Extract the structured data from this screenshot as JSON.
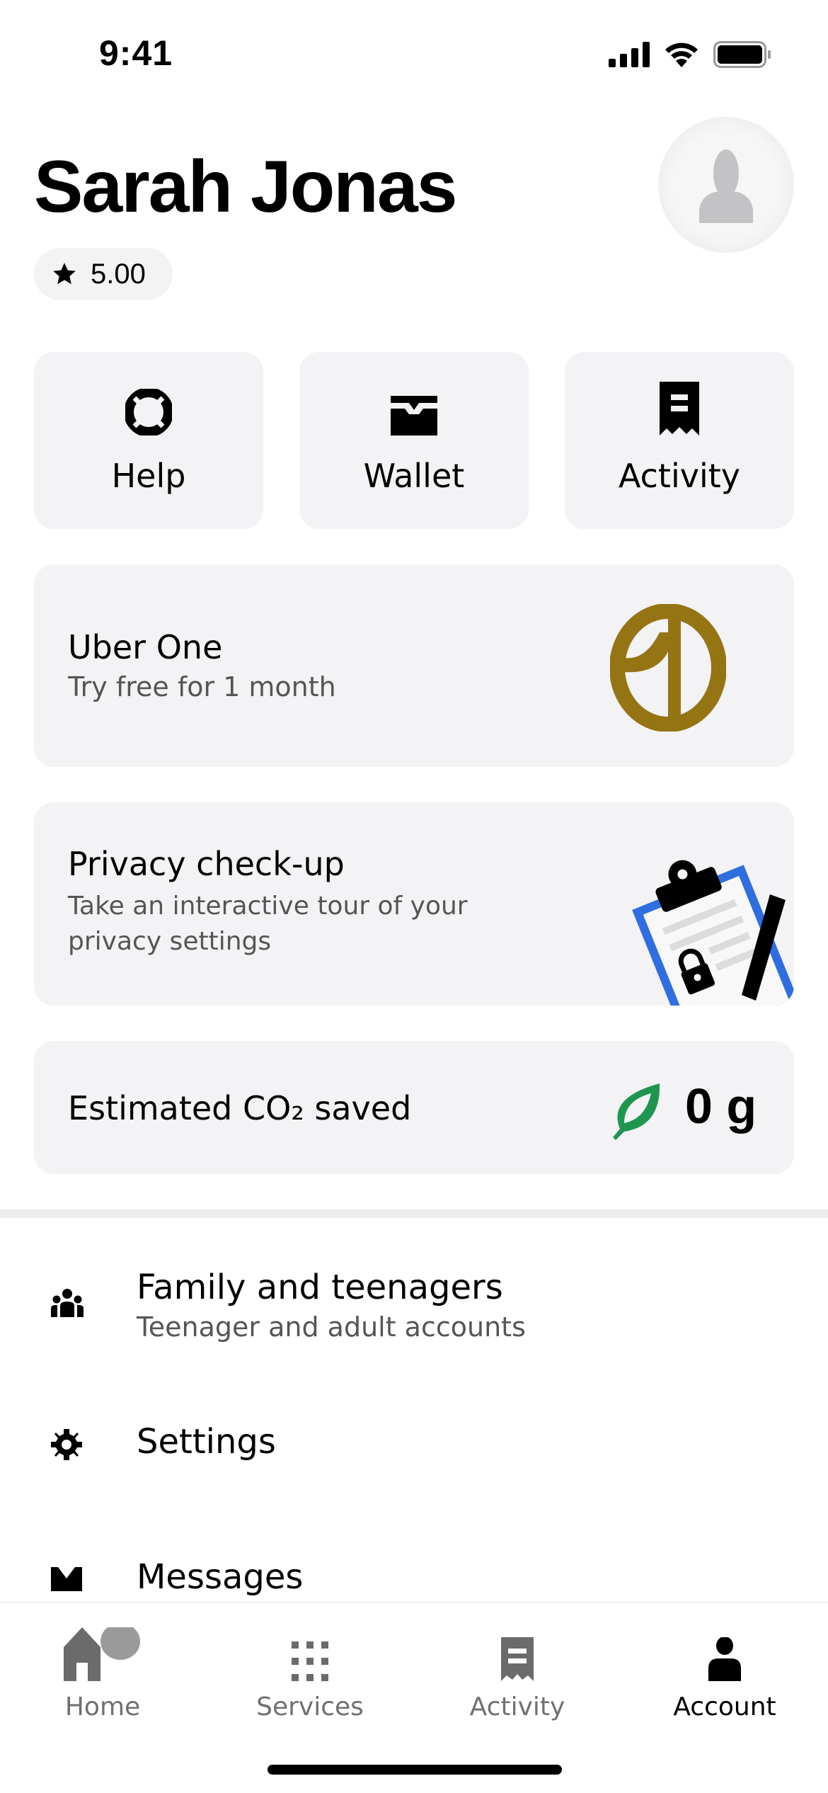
{
  "status_bar": {
    "time": "9:41"
  },
  "profile": {
    "name": "Sarah Jonas",
    "rating": "5.00"
  },
  "tiles": [
    {
      "label": "Help",
      "icon": "lifebuoy-icon"
    },
    {
      "label": "Wallet",
      "icon": "wallet-icon"
    },
    {
      "label": "Activity",
      "icon": "receipt-icon"
    }
  ],
  "uber_one": {
    "title": "Uber One",
    "subtitle": "Try free for 1 month",
    "accent": "#957414"
  },
  "privacy": {
    "title": "Privacy check-up",
    "subtitle": "Take an interactive tour of your privacy settings",
    "accent": "#2f6ee0"
  },
  "co2": {
    "label": "Estimated CO₂ saved",
    "value": "0 g",
    "accent": "#1e9650"
  },
  "menu": [
    {
      "title": "Family and teenagers",
      "subtitle": "Teenager and adult accounts",
      "icon": "family-icon"
    },
    {
      "title": "Settings",
      "icon": "gear-icon"
    },
    {
      "title": "Messages",
      "icon": "envelope-icon"
    }
  ],
  "tabbar": [
    {
      "label": "Home",
      "icon": "home-icon"
    },
    {
      "label": "Services",
      "icon": "grid-icon"
    },
    {
      "label": "Activity",
      "icon": "receipt-icon"
    },
    {
      "label": "Account",
      "icon": "person-icon",
      "active": true
    }
  ]
}
